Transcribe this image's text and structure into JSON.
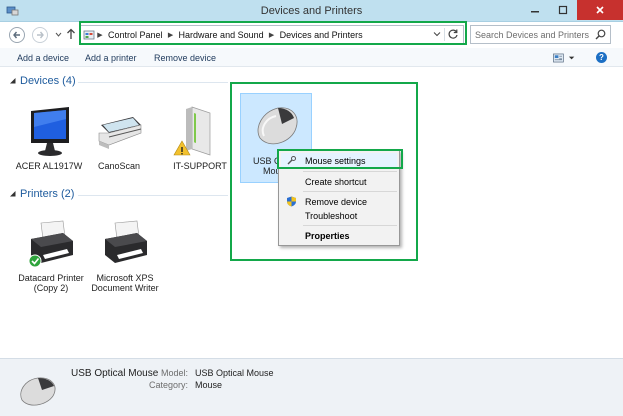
{
  "window": {
    "title": "Devices and Printers"
  },
  "nav": {
    "back_icon": "back-arrow-icon",
    "forward_icon": "forward-arrow-icon",
    "up_icon": "up-arrow-icon"
  },
  "address": {
    "crumbs": [
      "Control Panel",
      "Hardware and Sound",
      "Devices and Printers"
    ]
  },
  "search": {
    "placeholder": "Search Devices and Printers"
  },
  "commands": {
    "add_device": "Add a device",
    "add_printer": "Add a printer",
    "remove_device": "Remove device"
  },
  "groups": {
    "devices": {
      "header": "Devices (4)",
      "items": [
        {
          "label": "ACER AL1917W",
          "icon": "monitor-icon"
        },
        {
          "label": "CanoScan",
          "icon": "scanner-icon"
        },
        {
          "label": "IT-SUPPORT",
          "icon": "computer-tower-icon"
        },
        {
          "label_line1": "USB O",
          "label_line2": "Mou",
          "icon": "mouse-icon"
        }
      ]
    },
    "printers": {
      "header": "Printers (2)",
      "items": [
        {
          "label_line1": "Datacard Printer",
          "label_line2": "(Copy 2)",
          "icon": "printer-icon"
        },
        {
          "label_line1": "Microsoft XPS",
          "label_line2": "Document Writer",
          "icon": "printer-icon"
        }
      ]
    }
  },
  "context_menu": {
    "items": [
      {
        "label": "Mouse settings"
      },
      {
        "label": "Create shortcut"
      },
      {
        "label": "Remove device"
      },
      {
        "label": "Troubleshoot"
      },
      {
        "label": "Properties"
      }
    ]
  },
  "details": {
    "name": "USB Optical Mouse",
    "model_label": "Model:",
    "model_value": "USB Optical Mouse",
    "category_label": "Category:",
    "category_value": "Mouse"
  },
  "colors": {
    "highlight": "#13a84a",
    "group_header": "#1e5b9d",
    "close_button": "#c7312e"
  }
}
